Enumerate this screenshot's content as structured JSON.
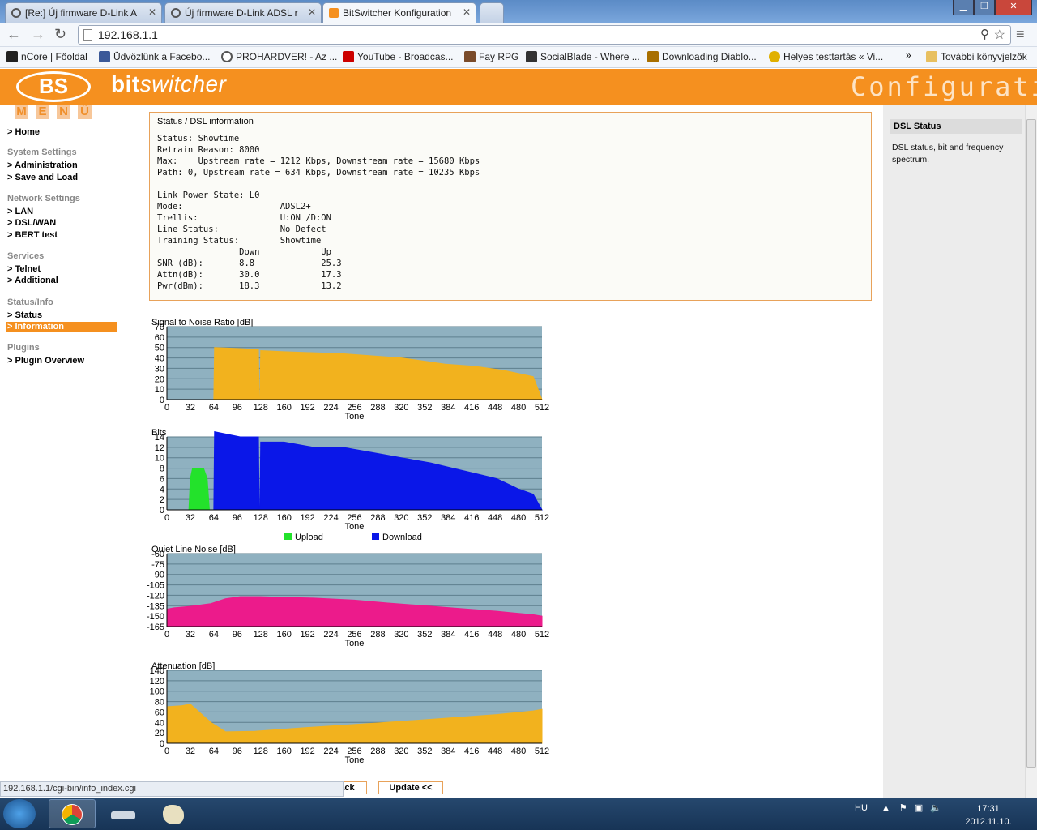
{
  "browser": {
    "tabs": [
      {
        "label": "[Re:] Új firmware D-Link A"
      },
      {
        "label": "Új firmware D-Link ADSL r"
      },
      {
        "label": "BitSwitcher Konfiguration"
      }
    ],
    "url": "192.168.1.1",
    "bookmarks": [
      {
        "label": "nCore | Főoldal",
        "color": "#222222"
      },
      {
        "label": "Üdvözlünk a Facebo...",
        "color": "#3b5998"
      },
      {
        "label": "PROHARDVER! - Az ...",
        "color": "#555555"
      },
      {
        "label": "YouTube - Broadcas...",
        "color": "#cc0000"
      },
      {
        "label": "Fay RPG",
        "color": "#7a4b2a"
      },
      {
        "label": "SocialBlade - Where ...",
        "color": "#333333"
      },
      {
        "label": "Downloading Diablo...",
        "color": "#a86f00"
      },
      {
        "label": "Helyes testtartás « Vi...",
        "color": "#e0b000"
      }
    ],
    "more_bookmarks": "További könyvjelzők",
    "status_url": "192.168.1.1/cgi-bin/info_index.cgi"
  },
  "header": {
    "logo": "BS",
    "brand_a": "bit",
    "brand_b": "switcher",
    "title": "Configuration"
  },
  "menu": {
    "letters": [
      "M",
      "E",
      "N",
      "Ü"
    ],
    "home": "> Home",
    "sections": [
      {
        "title": "System Settings",
        "items": [
          "> Administration",
          "> Save and Load"
        ]
      },
      {
        "title": "Network Settings",
        "items": [
          "> LAN",
          "> DSL/WAN",
          "> BERT test"
        ]
      },
      {
        "title": "Services",
        "items": [
          "> Telnet",
          "> Additional"
        ]
      },
      {
        "title": "Status/Info",
        "items": [
          "> Status",
          "> Information"
        ]
      },
      {
        "title": "Plugins",
        "items": [
          "> Plugin Overview"
        ]
      }
    ],
    "active": "> Information"
  },
  "dsl": {
    "caption": "Status / DSL information",
    "lines": [
      "Status: Showtime",
      "Retrain Reason: 8000",
      "Max:    Upstream rate = 1212 Kbps, Downstream rate = 15680 Kbps",
      "Path: 0, Upstream rate = 634 Kbps, Downstream rate = 10235 Kbps",
      "",
      "Link Power State: L0",
      "Mode:                   ADSL2+",
      "Trellis:                U:ON /D:ON",
      "Line Status:            No Defect",
      "Training Status:        Showtime",
      "                Down            Up",
      "SNR (dB):       8.8             25.3",
      "Attn(dB):       30.0            17.3",
      "Pwr(dBm):       18.3            13.2"
    ]
  },
  "help": {
    "title": "DSL Status",
    "text": "DSL status, bit and frequency spectrum."
  },
  "buttons": {
    "back": "<< Back",
    "update": "Update <<"
  },
  "taskbar": {
    "lang": "HU",
    "time": "17:31",
    "date": "2012.11.10."
  },
  "colors": {
    "orange": "#f5901f",
    "plot_bg": "#8fb1c0",
    "yellow": "#f2b21e",
    "blue": "#0a17e8",
    "green": "#23e22b",
    "pink": "#ec1b8b"
  },
  "chart_data": [
    {
      "type": "area",
      "title": "Signal to Noise Ratio [dB]",
      "xlabel": "Tone",
      "xlim": [
        0,
        512
      ],
      "ylim": [
        0,
        70
      ],
      "xticks": [
        0,
        32,
        64,
        96,
        128,
        160,
        192,
        224,
        256,
        288,
        320,
        352,
        384,
        416,
        448,
        480,
        512
      ],
      "yticks": [
        0,
        10,
        20,
        30,
        40,
        50,
        60,
        70
      ],
      "series": [
        {
          "x": [
            64,
            65,
            100,
            125,
            126,
            127,
            128,
            160,
            200,
            240,
            280,
            320,
            350,
            380,
            420,
            460,
            500,
            512
          ],
          "values": [
            0,
            50,
            49,
            48,
            0,
            0,
            47,
            46,
            45,
            44,
            42,
            40,
            37,
            34,
            32,
            28,
            22,
            0
          ]
        }
      ]
    },
    {
      "type": "area",
      "title": "Bits",
      "xlabel": "Tone",
      "xlim": [
        0,
        512
      ],
      "ylim": [
        0,
        14
      ],
      "xticks": [
        0,
        32,
        64,
        96,
        128,
        160,
        192,
        224,
        256,
        288,
        320,
        352,
        384,
        416,
        448,
        480,
        512
      ],
      "yticks": [
        0,
        2,
        4,
        6,
        8,
        10,
        12,
        14
      ],
      "legend": "bottom",
      "series": [
        {
          "name": "Upload",
          "x": [
            30,
            32,
            35,
            40,
            50,
            55,
            58
          ],
          "values": [
            0,
            6,
            8,
            8,
            8,
            6,
            0
          ]
        },
        {
          "name": "Download",
          "x": [
            64,
            65,
            100,
            125,
            126,
            127,
            128,
            160,
            200,
            240,
            280,
            320,
            360,
            390,
            420,
            450,
            480,
            500,
            512
          ],
          "values": [
            0,
            15,
            14,
            14,
            0,
            0,
            13,
            13,
            12,
            12,
            11,
            10,
            9,
            8,
            7,
            6,
            4,
            3,
            0
          ]
        }
      ]
    },
    {
      "type": "area",
      "title": "Quiet Line Noise [dB]",
      "xlabel": "Tone",
      "xlim": [
        0,
        512
      ],
      "ylim": [
        -165,
        -60
      ],
      "xticks": [
        0,
        32,
        64,
        96,
        128,
        160,
        192,
        224,
        256,
        288,
        320,
        352,
        384,
        416,
        448,
        480,
        512
      ],
      "yticks": [
        -60,
        -75,
        -90,
        -105,
        -120,
        -135,
        -150,
        -165
      ],
      "series": [
        {
          "x": [
            0,
            10,
            32,
            60,
            80,
            100,
            128,
            160,
            200,
            256,
            300,
            350,
            400,
            450,
            500,
            512
          ],
          "values": [
            -140,
            -138,
            -136,
            -132,
            -125,
            -122,
            -122,
            -123,
            -124,
            -127,
            -131,
            -135,
            -139,
            -143,
            -148,
            -150
          ]
        }
      ]
    },
    {
      "type": "area",
      "title": "Attenuation [dB]",
      "xlabel": "Tone",
      "xlim": [
        0,
        512
      ],
      "ylim": [
        0,
        140
      ],
      "xticks": [
        0,
        32,
        64,
        96,
        128,
        160,
        192,
        224,
        256,
        288,
        320,
        352,
        384,
        416,
        448,
        480,
        512
      ],
      "yticks": [
        0,
        20,
        40,
        60,
        80,
        100,
        120,
        140
      ],
      "series": [
        {
          "x": [
            0,
            20,
            32,
            40,
            60,
            80,
            120,
            160,
            200,
            256,
            300,
            350,
            400,
            450,
            500,
            512
          ],
          "values": [
            70,
            72,
            75,
            65,
            40,
            22,
            23,
            27,
            31,
            36,
            40,
            45,
            50,
            55,
            62,
            65
          ]
        }
      ]
    }
  ]
}
